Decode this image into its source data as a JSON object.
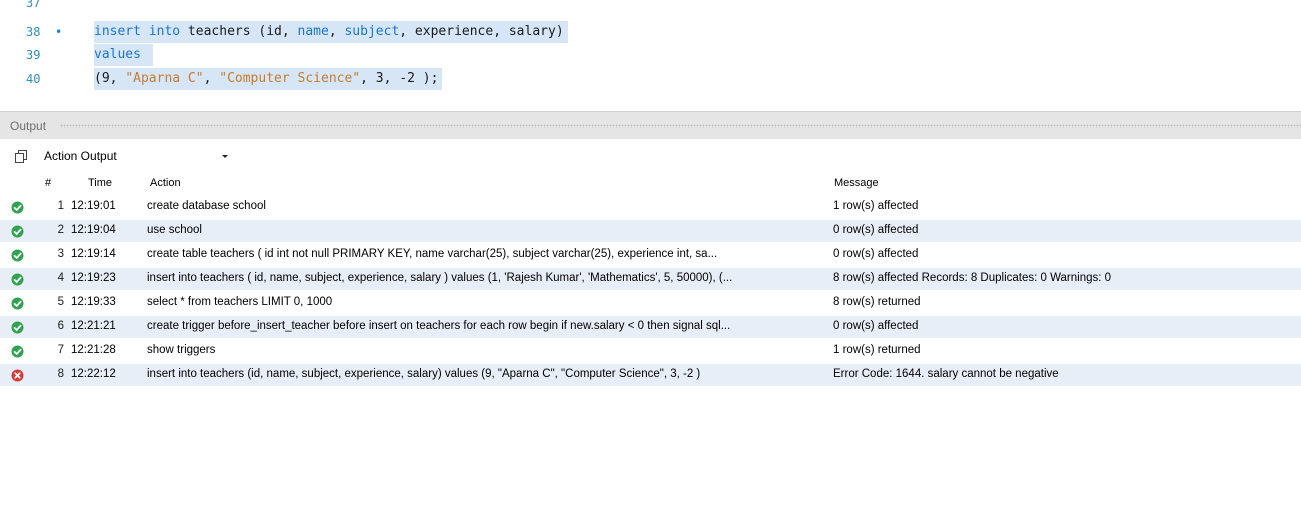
{
  "editor": {
    "lines": [
      {
        "num": "37",
        "marker": "",
        "tokens": []
      },
      {
        "num": "38",
        "marker": "•",
        "tokens": [
          {
            "t": "insert",
            "c": "kw"
          },
          {
            "t": " ",
            "c": "plain"
          },
          {
            "t": "into",
            "c": "kw"
          },
          {
            "t": " teachers (id, ",
            "c": "plain"
          },
          {
            "t": "name",
            "c": "kw"
          },
          {
            "t": ", ",
            "c": "plain"
          },
          {
            "t": "subject",
            "c": "kw"
          },
          {
            "t": ", experience, salary)",
            "c": "plain"
          }
        ]
      },
      {
        "num": "39",
        "marker": "",
        "tokens": [
          {
            "t": "values",
            "c": "kw"
          },
          {
            "t": " ",
            "c": "plain"
          }
        ]
      },
      {
        "num": "40",
        "marker": "",
        "tokens": [
          {
            "t": "(9, ",
            "c": "plain"
          },
          {
            "t": "\"Aparna C\"",
            "c": "str"
          },
          {
            "t": ", ",
            "c": "plain"
          },
          {
            "t": "\"Computer Science\"",
            "c": "str"
          },
          {
            "t": ", 3, -2 );",
            "c": "plain"
          }
        ]
      }
    ]
  },
  "output": {
    "title": "Output",
    "dropdown_value": "Action Output",
    "columns": {
      "num": "#",
      "time": "Time",
      "action": "Action",
      "message": "Message"
    },
    "rows": [
      {
        "status": "ok",
        "num": "1",
        "time": "12:19:01",
        "action": "create database school",
        "message": "1 row(s) affected"
      },
      {
        "status": "ok",
        "num": "2",
        "time": "12:19:04",
        "action": "use school",
        "message": "0 row(s) affected"
      },
      {
        "status": "ok",
        "num": "3",
        "time": "12:19:14",
        "action": "create table teachers ( id int not null PRIMARY KEY,  name varchar(25),  subject varchar(25),  experience int,  sa...",
        "message": "0 row(s) affected"
      },
      {
        "status": "ok",
        "num": "4",
        "time": "12:19:23",
        "action": "insert into teachers ( id, name, subject, experience, salary ) values  (1, 'Rajesh Kumar', 'Mathematics', 5, 50000), (...",
        "message": "8 row(s) affected Records: 8  Duplicates: 0  Warnings: 0"
      },
      {
        "status": "ok",
        "num": "5",
        "time": "12:19:33",
        "action": "select * from teachers LIMIT 0, 1000",
        "message": "8 row(s) returned"
      },
      {
        "status": "ok",
        "num": "6",
        "time": "12:21:21",
        "action": "create trigger before_insert_teacher before insert on teachers for each row begin if new.salary < 0 then signal sql...",
        "message": "0 row(s) affected"
      },
      {
        "status": "ok",
        "num": "7",
        "time": "12:21:28",
        "action": "show triggers",
        "message": "1 row(s) returned"
      },
      {
        "status": "error",
        "num": "8",
        "time": "12:22:12",
        "action": "insert into teachers (id, name, subject, experience, salary) values  (9, \"Aparna C\", \"Computer Science\", 3, -2 )",
        "message": "Error Code: 1644. salary cannot be negative"
      }
    ]
  },
  "colors": {
    "ok": "#2ea44f",
    "error": "#d63b3b",
    "keyword": "#1b76c7",
    "string": "#c77d2a",
    "selection": "#d6e6f7",
    "alt_row": "#e8eef7"
  },
  "icons": {
    "ok": "check-circle-icon",
    "error": "error-x-circle-icon",
    "copy": "copy-icon",
    "dropdown": "chevron-down-icon"
  }
}
